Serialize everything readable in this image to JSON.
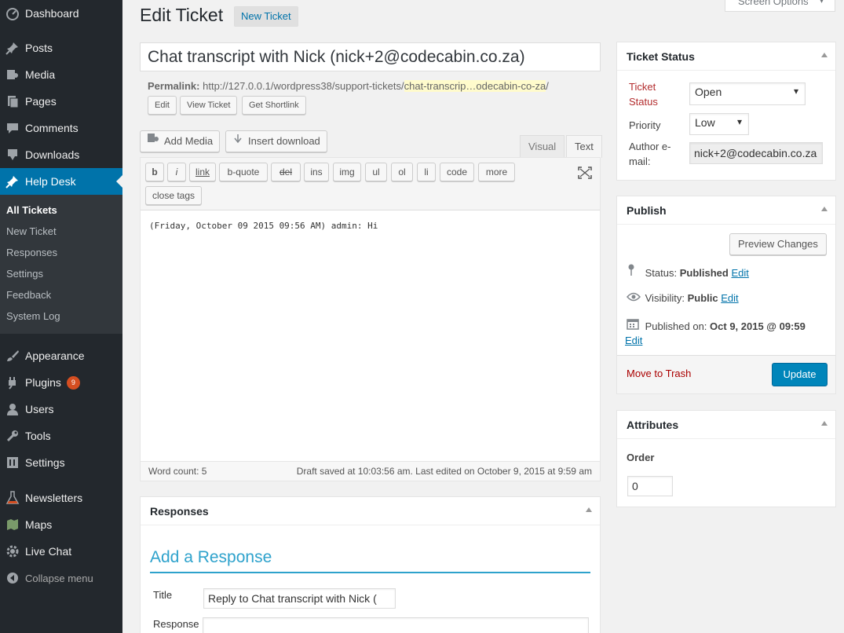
{
  "menu": {
    "items": [
      {
        "label": "Dashboard",
        "icon": "dashboard-icon"
      },
      {
        "label": "Posts",
        "icon": "pin-icon"
      },
      {
        "label": "Media",
        "icon": "media-icon"
      },
      {
        "label": "Pages",
        "icon": "pages-icon"
      },
      {
        "label": "Comments",
        "icon": "comments-icon"
      },
      {
        "label": "Downloads",
        "icon": "downloads-icon"
      },
      {
        "label": "Help Desk",
        "icon": "pin-icon"
      },
      {
        "label": "Appearance",
        "icon": "brush-icon"
      },
      {
        "label": "Plugins",
        "icon": "plugin-icon",
        "badge": "9"
      },
      {
        "label": "Users",
        "icon": "users-icon"
      },
      {
        "label": "Tools",
        "icon": "wrench-icon"
      },
      {
        "label": "Settings",
        "icon": "settings-icon"
      },
      {
        "label": "Newsletters",
        "icon": "flask-icon"
      },
      {
        "label": "Maps",
        "icon": "map-icon"
      },
      {
        "label": "Live Chat",
        "icon": "gear-icon"
      }
    ],
    "submenu": [
      "All Tickets",
      "New Ticket",
      "Responses",
      "Settings",
      "Feedback",
      "System Log"
    ],
    "collapse": "Collapse menu"
  },
  "header": {
    "title": "Edit Ticket",
    "new_ticket": "New Ticket",
    "screen_options": "Screen Options"
  },
  "post": {
    "title": "Chat transcript with Nick (nick+2@codecabin.co.za)",
    "permalink_label": "Permalink:",
    "permalink_base": "http://127.0.0.1/wordpress38/support-tickets/",
    "permalink_slug": "chat-transcrip…odecabin-co-za",
    "permalink_end": "/",
    "buttons": [
      "Edit",
      "View Ticket",
      "Get Shortlink"
    ]
  },
  "editor": {
    "add_media": "Add Media",
    "insert_download": "Insert download",
    "tab_visual": "Visual",
    "tab_text": "Text",
    "quicktags": [
      "b",
      "i",
      "link",
      "b-quote",
      "del",
      "ins",
      "img",
      "ul",
      "ol",
      "li",
      "code",
      "more",
      "close tags"
    ],
    "content": "(Friday, October 09 2015 09:56 AM) admin: Hi",
    "word_count": "Word count: 5",
    "draft_saved": "Draft saved at 10:03:56 am. Last edited on October 9, 2015 at 9:59 am"
  },
  "responses": {
    "title": "Responses",
    "add_heading": "Add a Response",
    "title_label": "Title",
    "title_value": "Reply to Chat transcript with Nick (",
    "response_label": "Response"
  },
  "ticket_status": {
    "title": "Ticket Status",
    "status_label": "Ticket Status",
    "status_value": "Open",
    "priority_label": "Priority",
    "priority_value": "Low",
    "email_label": "Author e-mail:",
    "email_value": "nick+2@codecabin.co.za"
  },
  "publish": {
    "title": "Publish",
    "preview": "Preview Changes",
    "status_label": "Status:",
    "status_value": "Published",
    "visibility_label": "Visibility:",
    "visibility_value": "Public",
    "published_label": "Published on:",
    "published_value": "Oct 9, 2015 @ 09:59",
    "edit": "Edit",
    "trash": "Move to Trash",
    "update": "Update"
  },
  "attributes": {
    "title": "Attributes",
    "order_label": "Order",
    "order_value": "0"
  },
  "colors": {
    "menu_bg": "#23282d",
    "accent": "#0073aa",
    "badge": "#d54e21",
    "update_btn": "#0085ba"
  }
}
